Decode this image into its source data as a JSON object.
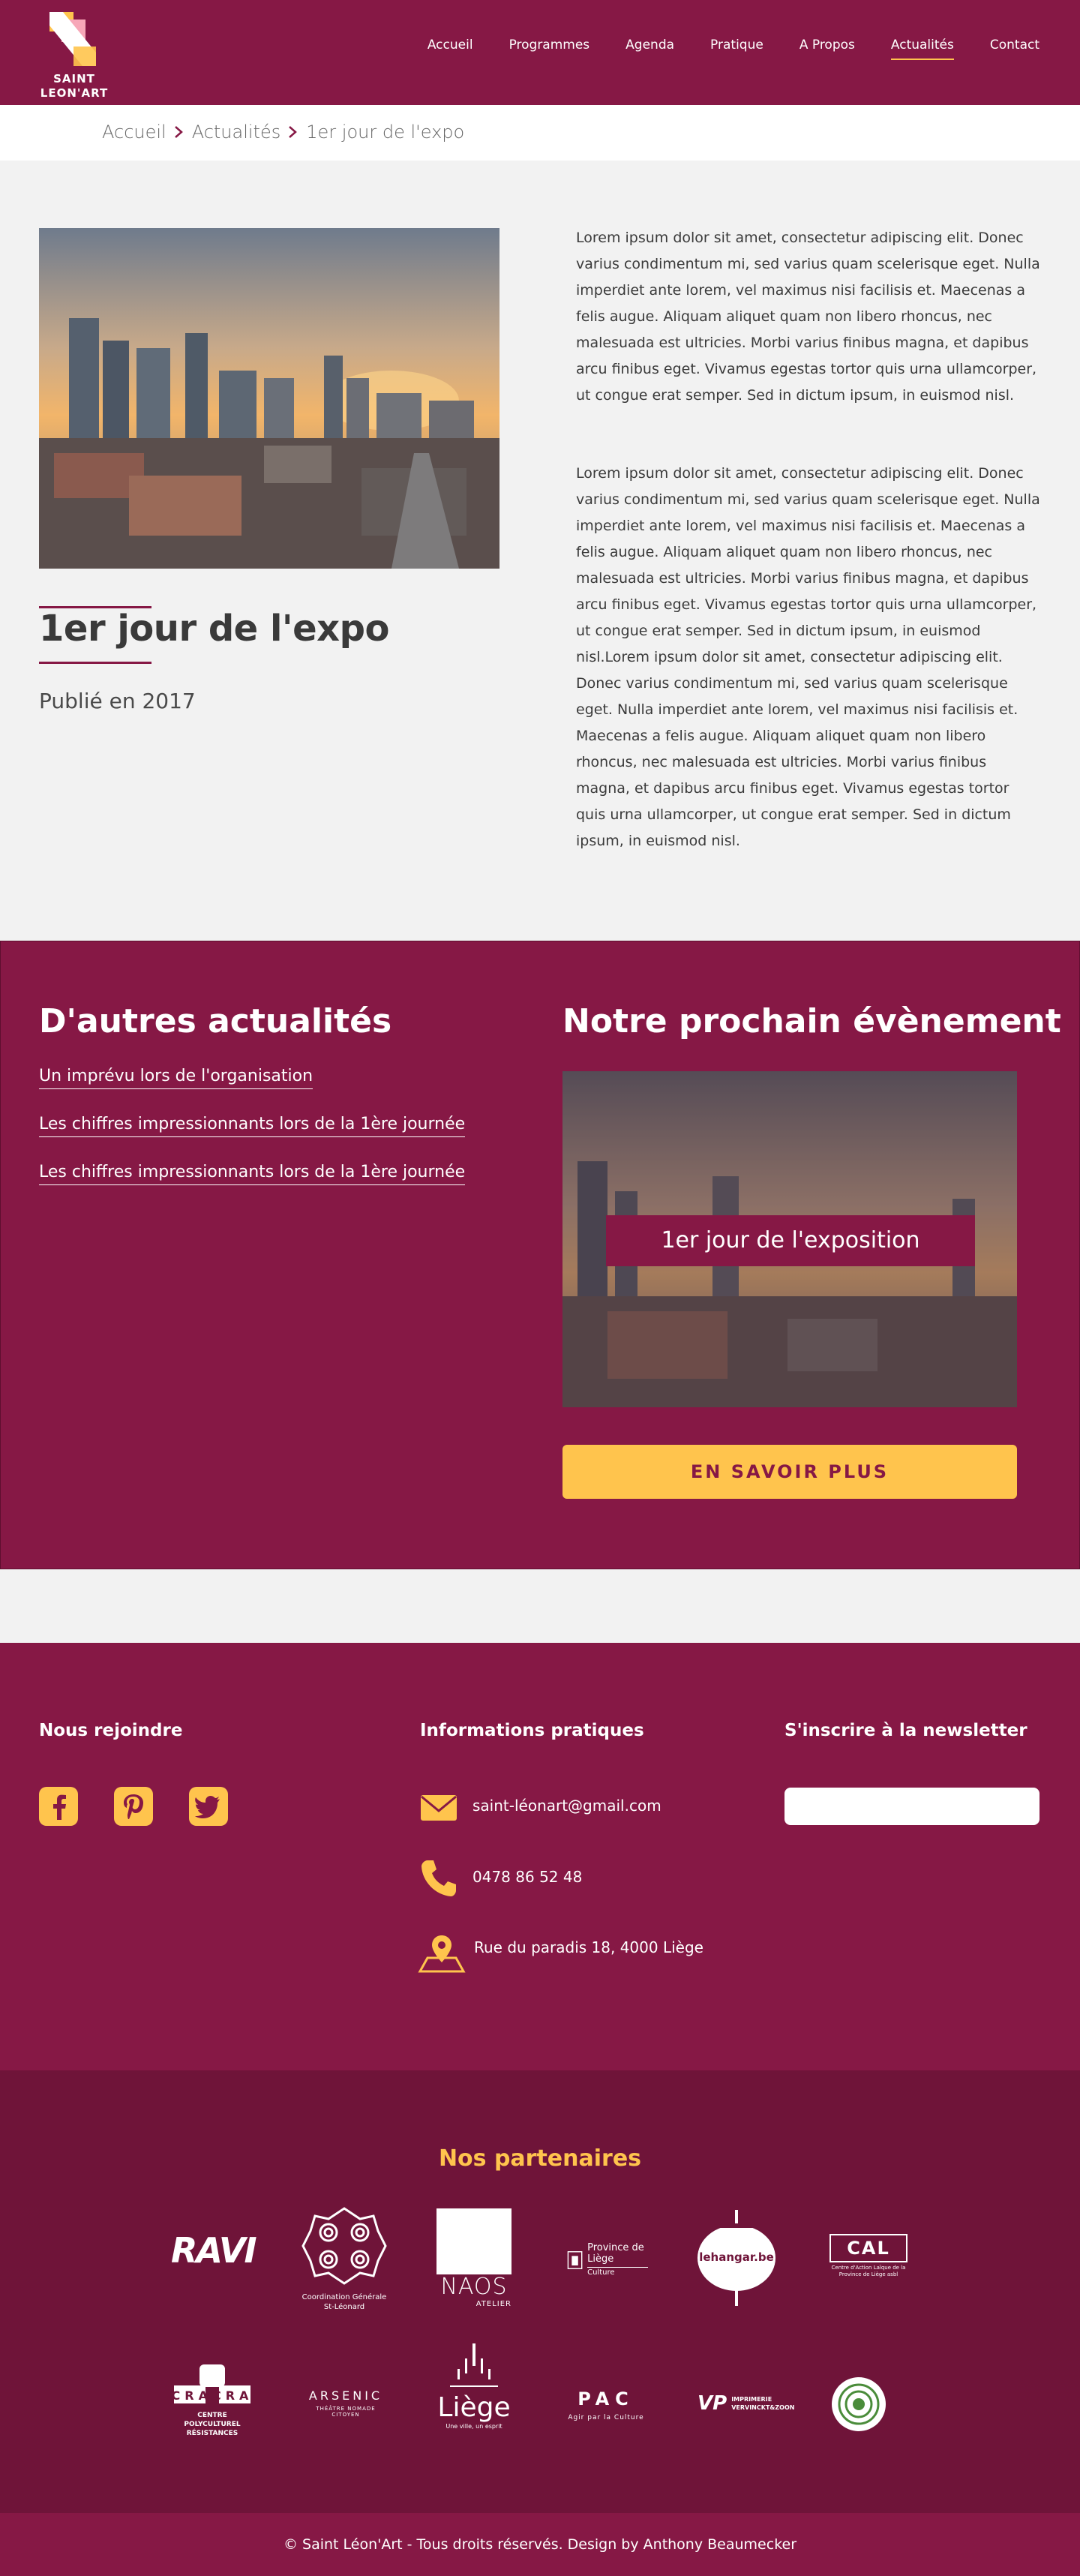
{
  "header": {
    "logo_text_line1": "SAINT",
    "logo_text_line2": "LEON'ART",
    "nav": [
      {
        "label": "Accueil"
      },
      {
        "label": "Programmes"
      },
      {
        "label": "Agenda"
      },
      {
        "label": "Pratique"
      },
      {
        "label": "A Propos"
      },
      {
        "label": "Actualités",
        "active": true
      },
      {
        "label": "Contact"
      }
    ]
  },
  "breadcrumb": [
    "Accueil",
    "Actualités",
    "1er jour de l'expo"
  ],
  "article": {
    "title": "1er jour de l'expo",
    "date": "Publié en 2017",
    "paragraph1": "Lorem ipsum dolor sit amet, consectetur adipiscing elit. Donec varius condimentum mi, sed varius quam scelerisque eget. Nulla imperdiet ante lorem, vel maximus nisi facilisis et. Maecenas a felis augue. Aliquam aliquet quam non libero rhoncus, nec malesuada est ultricies. Morbi varius finibus magna, et dapibus arcu finibus eget. Vivamus egestas tortor quis urna ullamcorper, ut congue erat semper. Sed in dictum ipsum, in euismod nisl.",
    "paragraph2": "Lorem ipsum dolor sit amet, consectetur adipiscing elit. Donec varius condimentum mi, sed varius quam scelerisque eget. Nulla imperdiet ante lorem, vel maximus nisi facilisis et. Maecenas a felis augue. Aliquam aliquet quam non libero rhoncus, nec malesuada est ultricies. Morbi varius finibus magna, et dapibus arcu finibus eget. Vivamus egestas tortor quis urna ullamcorper, ut congue erat semper. Sed in dictum ipsum, in euismod nisl.Lorem ipsum dolor sit amet, consectetur adipiscing elit. Donec varius condimentum mi, sed varius quam scelerisque eget. Nulla imperdiet ante lorem, vel maximus nisi facilisis et. Maecenas a felis augue. Aliquam aliquet quam non libero rhoncus, nec malesuada est ultricies. Morbi varius finibus magna, et dapibus arcu finibus eget. Vivamus egestas tortor quis urna ullamcorper, ut congue erat semper. Sed in dictum ipsum, in euismod nisl."
  },
  "other_news": {
    "title": "D'autres actualités",
    "links": [
      "Un imprévu lors de l'organisation",
      "Les chiffres impressionnants lors de la 1ère journée",
      "Les chiffres impressionnants lors de la 1ère journée"
    ]
  },
  "next_event": {
    "title": "Notre prochain évènement",
    "label": "1er jour de l'exposition",
    "cta": "EN SAVOIR PLUS"
  },
  "footer": {
    "join_title": "Nous rejoindre",
    "info_title": "Informations pratiques",
    "newsletter_title": "S'inscrire à la newsletter",
    "email": "saint-léonart@gmail.com",
    "phone": "0478 86 52 48",
    "address": "Rue du paradis 18, 4000 Liège",
    "social_icons": [
      "facebook-icon",
      "pinterest-icon",
      "twitter-icon"
    ]
  },
  "partners": {
    "title": "Nos partenaires",
    "row1": [
      {
        "name": "RAVI"
      },
      {
        "name": "Coordination Générale St-Léonard"
      },
      {
        "name": "NAOS",
        "sub": "ATELIER"
      },
      {
        "name": "Province de Liège",
        "sub": "Culture"
      },
      {
        "name": "lehangar.be"
      },
      {
        "name": "CAL",
        "sub": "Centre d'Action Laïque de la Province de Liège asbl"
      }
    ],
    "row2": [
      {
        "name": "CRACRA",
        "sub": "CENTRE POLYCULTUREL RÉSISTANCES"
      },
      {
        "name": "ARSENIC",
        "sub": "THÉÂTRE NOMADE CITOYEN"
      },
      {
        "name": "Liège",
        "sub": "Une ville, un esprit"
      },
      {
        "name": "PAC",
        "sub": "Agir par la Culture"
      },
      {
        "name": "VP",
        "sub": "IMPRIMERIE VERVINCKT&ZOON"
      },
      {
        "name": "circle-logo"
      }
    ]
  },
  "copyright": "© Saint Léon'Art - Tous droits réservés. Design by Anthony Beaumecker",
  "colors": {
    "primary": "#861845",
    "accent": "#ffc44d",
    "dark": "#6f1439",
    "light_bg": "#f2f2f2"
  }
}
